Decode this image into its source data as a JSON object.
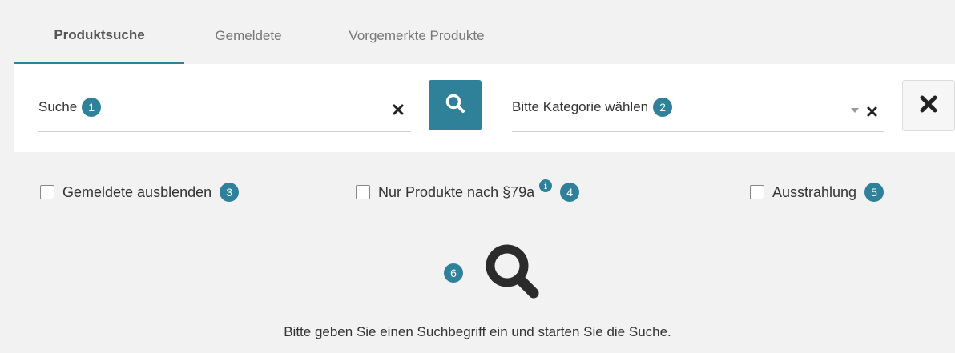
{
  "tabs": [
    {
      "label": "Produktsuche",
      "active": true
    },
    {
      "label": "Gemeldete",
      "active": false
    },
    {
      "label": "Vorgemerkte Produkte",
      "active": false
    }
  ],
  "search": {
    "label": "Suche",
    "badge": "1",
    "value": ""
  },
  "category": {
    "label": "Bitte Kategorie wählen",
    "badge": "2"
  },
  "filters": [
    {
      "label": "Gemeldete ausblenden",
      "badge": "3",
      "checked": false
    },
    {
      "label": "Nur Produkte nach §79a",
      "badge": "4",
      "checked": false,
      "info": "i"
    },
    {
      "label": "Ausstrahlung",
      "badge": "5",
      "checked": false
    }
  ],
  "empty_state": {
    "badge": "6",
    "message": "Bitte geben Sie einen Suchbegriff ein und starten Sie die Suche."
  },
  "colors": {
    "accent": "#2f8199",
    "background": "#f2f2f2",
    "panel": "#ffffff"
  },
  "icons": {
    "search_button": "search-icon",
    "reset_button": "close-icon",
    "empty_state": "search-icon"
  }
}
